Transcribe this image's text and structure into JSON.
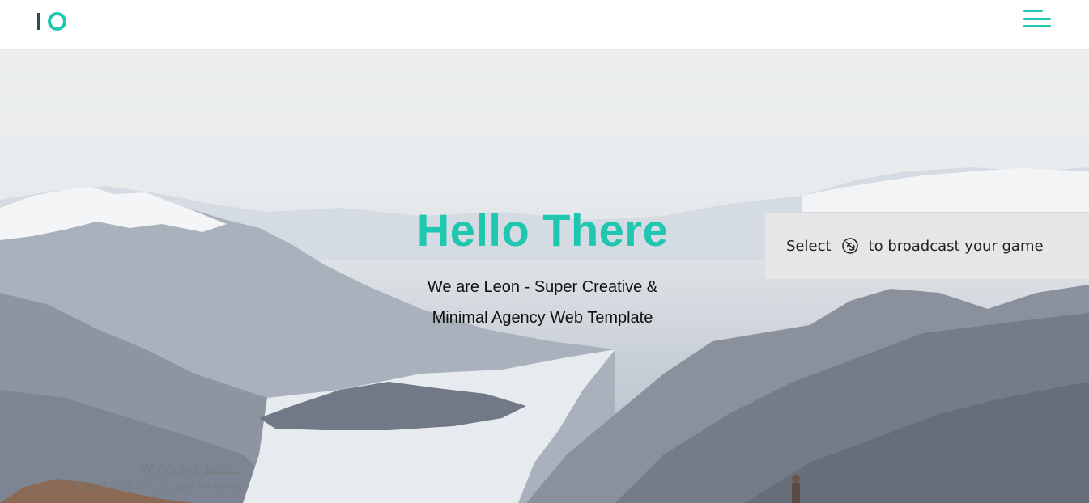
{
  "header": {
    "logo_icon": "io-logo",
    "menu_icon": "hamburger-menu-icon",
    "accent": "#1fc7b1"
  },
  "hero": {
    "title": "Hello There",
    "subtitle_line1": "We are Leon - Super Creative &",
    "subtitle_line2": "Minimal Agency Web Template",
    "background_image": "mountain-lake-landscape"
  },
  "cast_popup": {
    "text_before": "Select",
    "icon": "cast-icon",
    "text_after": "to broadcast your game"
  },
  "watermark": {
    "line1": "Windows تنشيط",
    "line2": "انتقل إلى الإعدادات لتنشيط Windows."
  }
}
